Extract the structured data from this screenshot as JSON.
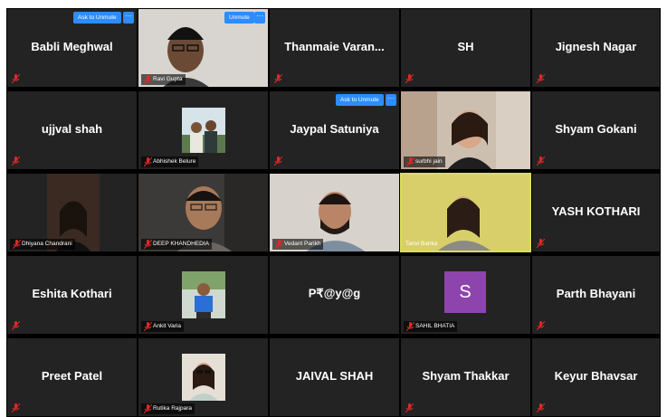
{
  "participants": [
    {
      "name": "Babli Meghwal",
      "display": "center",
      "unmute_label": "Ask to Unmute",
      "more_label": "···"
    },
    {
      "name": "Ravi Gupta",
      "display": "video",
      "unmute_label": "Unmute",
      "more_label": "···"
    },
    {
      "name": "Thanmaie  Varan...",
      "display": "center"
    },
    {
      "name": "SH",
      "display": "center"
    },
    {
      "name": "Jignesh Nagar",
      "display": "center"
    },
    {
      "name": "ujjval shah",
      "display": "center"
    },
    {
      "name": "Abhishek Belure",
      "display": "photo"
    },
    {
      "name": "Jaypal Satuniya",
      "display": "center",
      "unmute_label": "Ask to Unmute",
      "more_label": "···"
    },
    {
      "name": "surbhi jain",
      "display": "video"
    },
    {
      "name": "Shyam Gokani",
      "display": "center"
    },
    {
      "name": "Dhiyana Chandrani",
      "display": "video"
    },
    {
      "name": "DEEP KHANDHEDIA",
      "display": "video"
    },
    {
      "name": "Vedant Parikh",
      "display": "video"
    },
    {
      "name": "Tanvi Banka",
      "display": "video",
      "active": true
    },
    {
      "name": "YASH KOTHARI",
      "display": "center"
    },
    {
      "name": "Eshita Kothari",
      "display": "center"
    },
    {
      "name": "Ankit Varia",
      "display": "photo"
    },
    {
      "name": "P₹@y@g",
      "display": "center"
    },
    {
      "name": "SAHIL BHATIA",
      "display": "avatar",
      "initial": "S"
    },
    {
      "name": "Parth Bhayani",
      "display": "center"
    },
    {
      "name": "Preet Patel",
      "display": "center"
    },
    {
      "name": "Rutika Rajpara",
      "display": "photo"
    },
    {
      "name": "JAIVAL SHAH",
      "display": "center"
    },
    {
      "name": "Shyam Thakkar",
      "display": "center"
    },
    {
      "name": "Keyur Bhavsar",
      "display": "center"
    }
  ],
  "colors": {
    "accent": "#2d8cff",
    "active_border": "#d6e05a",
    "tile_bg": "#232323",
    "muted": "#e02828"
  }
}
